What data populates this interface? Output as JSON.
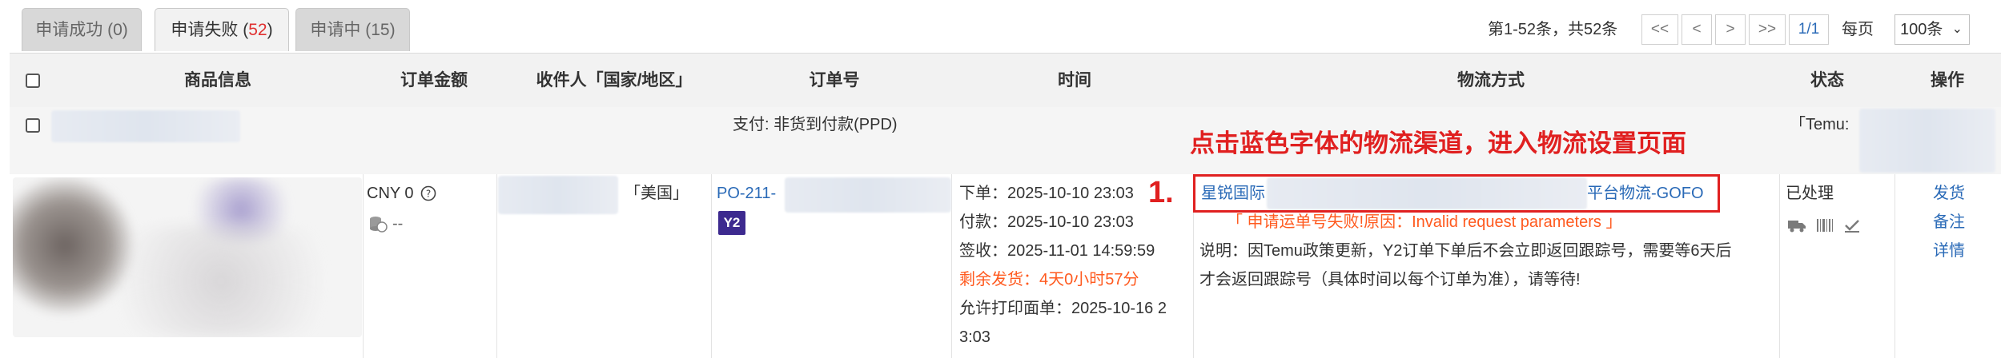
{
  "tabs": [
    {
      "label": "申请成功",
      "count": "(0)",
      "active": false
    },
    {
      "label": "申请失败",
      "count_open": "(",
      "count_value": "52",
      "count_close": ")",
      "active": true
    },
    {
      "label": "申请中",
      "count": "(15)",
      "active": false
    }
  ],
  "pagination": {
    "summary": "第1-52条，共52条",
    "first": "<<",
    "prev": "<",
    "next": ">",
    "last": ">>",
    "page": "1/1",
    "per_page_label": "每页",
    "per_page_value": "100条"
  },
  "table": {
    "headers": [
      "商品信息",
      "订单金额",
      "收件人「国家/地区」",
      "订单号",
      "时间",
      "物流方式",
      "状态",
      "操作"
    ],
    "group": {
      "payment": "支付: 非货到付款(PPD)",
      "shop_prefix": "「Temu:"
    },
    "row": {
      "amount": "CNY 0",
      "cost_value": "--",
      "country": "「美国」",
      "order_no_prefix": "PO-211-",
      "order_badge": "Y2",
      "time_lines": [
        "下单：2025-10-10 23:03",
        "付款：2025-10-10 23:03",
        "签收：2025-11-01 14:59:59"
      ],
      "time_remaining": "剩余发货：4天0小时57分",
      "time_print_line1": "允许打印面单：2025-10-16 2",
      "time_print_line2": "3:03",
      "logistics_prefix": "星锐国际",
      "logistics_suffix": "平台物流-GOFO",
      "error_text": "「 申请运单号失败!原因：Invalid request parameters 」",
      "note_line1": "说明：因Temu政策更新，Y2订单下单后不会立即返回跟踪号，需要等6天后",
      "note_line2": "才会返回跟踪号（具体时间以每个订单为准），请等待!",
      "status": "已处理",
      "actions": [
        "发货",
        "备注",
        "详情"
      ]
    }
  },
  "annotation": {
    "title": "点击蓝色字体的物流渠道，进入物流设置页面",
    "step": "1."
  },
  "colors": {
    "link_blue": "#2a6ab7",
    "error_orange": "#ff5a1f",
    "annotation_red": "#e02020",
    "badge_purple": "#3d2a8f"
  }
}
